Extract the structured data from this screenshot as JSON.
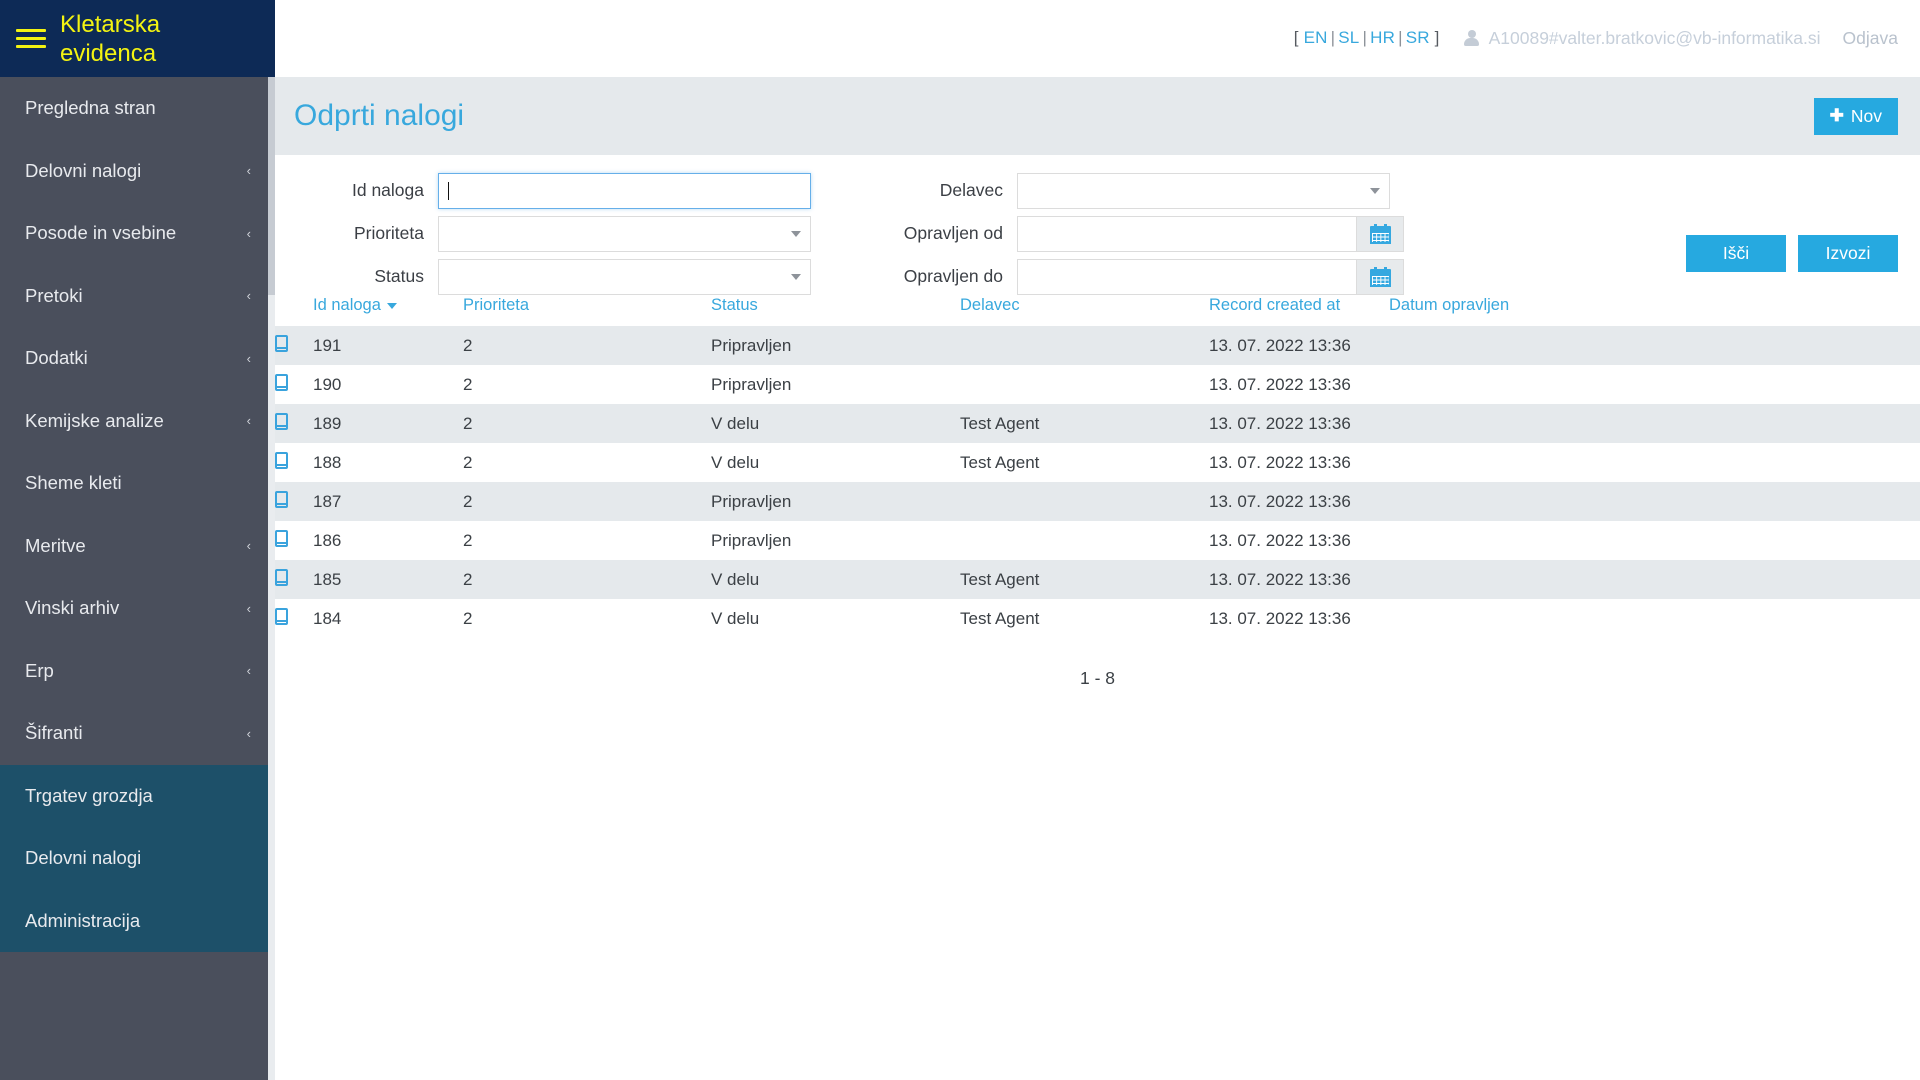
{
  "brand": {
    "title": "Kletarska evidenca",
    "menu_icon": "hamburger-icon"
  },
  "topbar": {
    "lang_open": "[",
    "lang_close": "]",
    "languages": [
      "EN",
      "SL",
      "HR",
      "SR"
    ],
    "separator": "|",
    "user": "A10089#valter.bratkovic@vb-informatika.si",
    "logout": "Odjava",
    "user_icon": "user-icon"
  },
  "sidebar": {
    "items": [
      {
        "label": "Pregledna stran",
        "chevron": "",
        "group": false
      },
      {
        "label": "Delovni nalogi",
        "chevron": "‹",
        "group": false
      },
      {
        "label": "Posode in vsebine",
        "chevron": "‹",
        "group": false
      },
      {
        "label": "Pretoki",
        "chevron": "‹",
        "group": false
      },
      {
        "label": "Dodatki",
        "chevron": "‹",
        "group": false
      },
      {
        "label": "Kemijske analize",
        "chevron": "‹",
        "group": false
      },
      {
        "label": "Sheme kleti",
        "chevron": "",
        "group": false
      },
      {
        "label": "Meritve",
        "chevron": "‹",
        "group": false
      },
      {
        "label": "Vinski arhiv",
        "chevron": "‹",
        "group": false
      },
      {
        "label": "Erp",
        "chevron": "‹",
        "group": false
      },
      {
        "label": "Šifranti",
        "chevron": "‹",
        "group": false
      },
      {
        "label": "Trgatev grozdja",
        "chevron": "",
        "group": true
      },
      {
        "label": "Delovni nalogi",
        "chevron": "",
        "group": true
      },
      {
        "label": "Administracija",
        "chevron": "",
        "group": true
      }
    ]
  },
  "page": {
    "title": "Odprti nalogi",
    "new_button": "Nov",
    "new_button_icon": "plus-icon"
  },
  "filters": {
    "id_naloga": {
      "label": "Id naloga",
      "value": "",
      "placeholder": ""
    },
    "prioriteta": {
      "label": "Prioriteta",
      "value": "",
      "placeholder": ""
    },
    "status": {
      "label": "Status",
      "value": "",
      "placeholder": ""
    },
    "delavec": {
      "label": "Delavec",
      "value": "",
      "placeholder": ""
    },
    "opravljen_od": {
      "label": "Opravljen od",
      "value": "",
      "placeholder": ""
    },
    "opravljen_do": {
      "label": "Opravljen do",
      "value": "",
      "placeholder": ""
    },
    "search_button": "Išči",
    "export_button": "Izvozi",
    "calendar_icon": "calendar-icon",
    "dropdown_icon": "chevron-down-icon"
  },
  "table": {
    "columns": [
      {
        "key": "icon",
        "label": ""
      },
      {
        "key": "id",
        "label": "Id naloga",
        "sorted": true,
        "sort_dir": "desc"
      },
      {
        "key": "prioriteta",
        "label": "Prioriteta"
      },
      {
        "key": "status",
        "label": "Status"
      },
      {
        "key": "delavec",
        "label": "Delavec"
      },
      {
        "key": "created",
        "label": "Record created at"
      },
      {
        "key": "done",
        "label": "Datum opravljen"
      }
    ],
    "rows": [
      {
        "icon": "tablet-icon",
        "id": "191",
        "prioriteta": "2",
        "status": "Pripravljen",
        "delavec": "",
        "created": "13. 07. 2022 13:36",
        "done": ""
      },
      {
        "icon": "tablet-icon",
        "id": "190",
        "prioriteta": "2",
        "status": "Pripravljen",
        "delavec": "",
        "created": "13. 07. 2022 13:36",
        "done": ""
      },
      {
        "icon": "tablet-icon",
        "id": "189",
        "prioriteta": "2",
        "status": "V delu",
        "delavec": "Test Agent",
        "created": "13. 07. 2022 13:36",
        "done": ""
      },
      {
        "icon": "tablet-icon",
        "id": "188",
        "prioriteta": "2",
        "status": "V delu",
        "delavec": "Test Agent",
        "created": "13. 07. 2022 13:36",
        "done": ""
      },
      {
        "icon": "tablet-icon",
        "id": "187",
        "prioriteta": "2",
        "status": "Pripravljen",
        "delavec": "",
        "created": "13. 07. 2022 13:36",
        "done": ""
      },
      {
        "icon": "tablet-icon",
        "id": "186",
        "prioriteta": "2",
        "status": "Pripravljen",
        "delavec": "",
        "created": "13. 07. 2022 13:36",
        "done": ""
      },
      {
        "icon": "tablet-icon",
        "id": "185",
        "prioriteta": "2",
        "status": "V delu",
        "delavec": "Test Agent",
        "created": "13. 07. 2022 13:36",
        "done": ""
      },
      {
        "icon": "tablet-icon",
        "id": "184",
        "prioriteta": "2",
        "status": "V delu",
        "delavec": "Test Agent",
        "created": "13. 07. 2022 13:36",
        "done": ""
      }
    ],
    "pager": "1 - 8"
  },
  "colors": {
    "brand_bg": "#0d2a56",
    "brand_text": "#f3f312",
    "sidebar_bg": "#4a4f5c",
    "sidebar_group_bg": "#1d5069",
    "accent": "#26a9e0",
    "link": "#38a8dd",
    "page_head_bg": "#e5e9ec",
    "row_odd_bg": "#e5e9ec"
  }
}
